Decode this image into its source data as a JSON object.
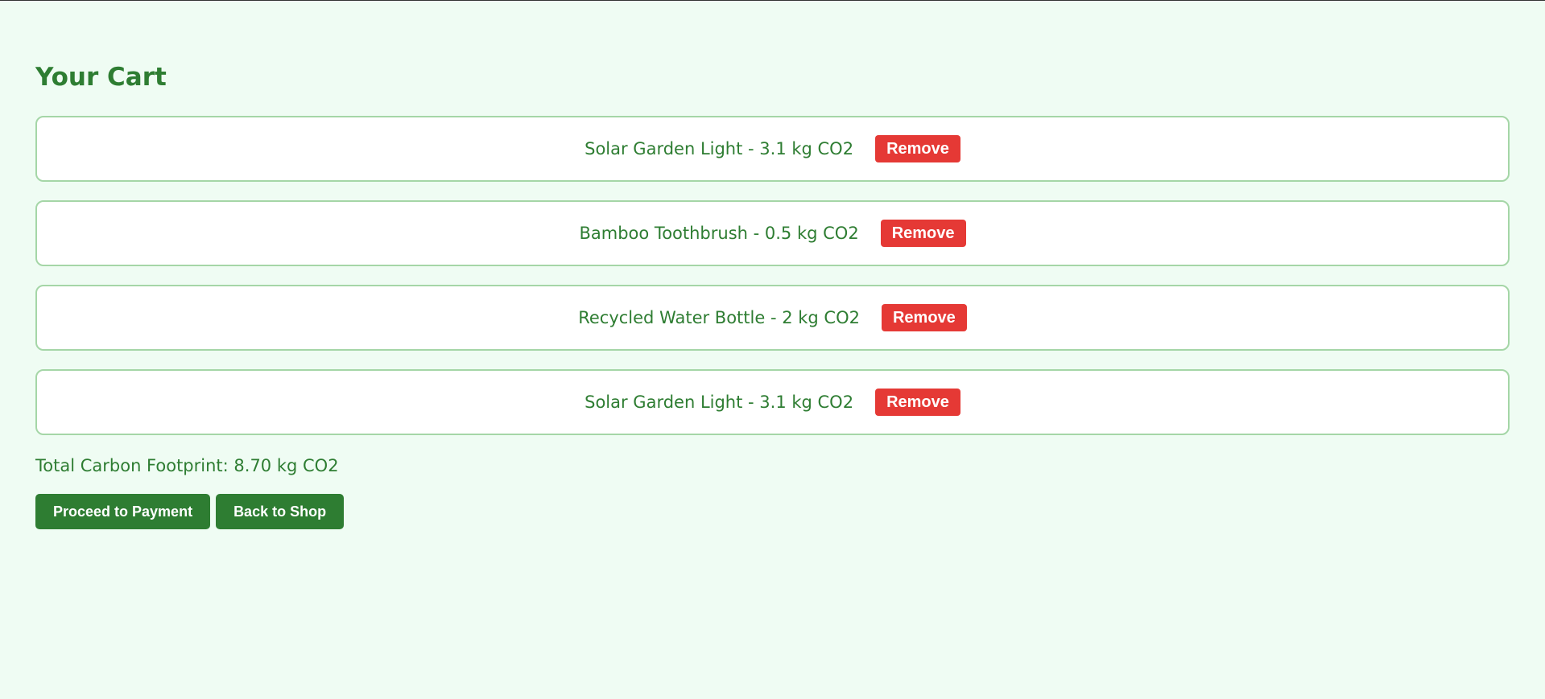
{
  "page": {
    "title": "Your Cart"
  },
  "cart": {
    "items": [
      {
        "label": "Solar Garden Light - 3.1 kg CO2",
        "remove_label": "Remove"
      },
      {
        "label": "Bamboo Toothbrush - 0.5 kg CO2",
        "remove_label": "Remove"
      },
      {
        "label": "Recycled Water Bottle - 2 kg CO2",
        "remove_label": "Remove"
      },
      {
        "label": "Solar Garden Light - 3.1 kg CO2",
        "remove_label": "Remove"
      }
    ],
    "total": "Total Carbon Footprint: 8.70 kg CO2"
  },
  "actions": {
    "proceed_label": "Proceed to Payment",
    "back_label": "Back to Shop"
  },
  "colors": {
    "background": "#effcf3",
    "primary_green": "#2e7d32",
    "item_border": "#a5d6a7",
    "remove_red": "#e53935"
  }
}
